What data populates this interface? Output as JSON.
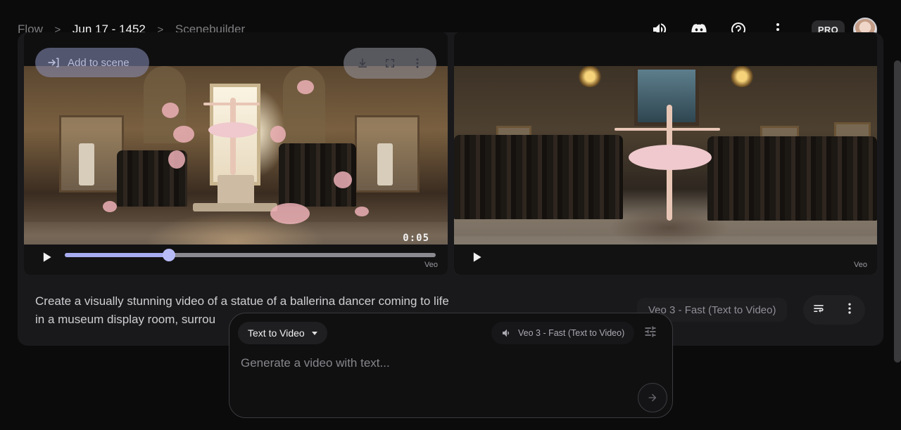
{
  "breadcrumb": {
    "items": [
      "Flow",
      "Jun 17 - 1452",
      "Scenebuilder"
    ],
    "separator": ">"
  },
  "header": {
    "pro_label": "PRO",
    "icons": [
      "volume-icon",
      "discord-icon",
      "help-icon",
      "more-vert-icon"
    ]
  },
  "clips": [
    {
      "add_to_scene_label": "Add to scene",
      "timecode": "0:05",
      "progress_fraction": 0.28,
      "model_badge": "Veo"
    },
    {
      "model_badge": "Veo"
    }
  ],
  "prompt": {
    "text": "Create a visually stunning video of a statue of a ballerina dancer coming to life in a museum display room, surrou",
    "model_label": "Veo 3 - Fast (Text to Video)"
  },
  "composer": {
    "mode_label": "Text to Video",
    "model_label": "Veo 3 - Fast (Text to Video)",
    "placeholder": "Generate a video with text..."
  },
  "colors": {
    "accent": "#a7acf0",
    "background": "#0b0b0c",
    "card": "#19191b"
  }
}
